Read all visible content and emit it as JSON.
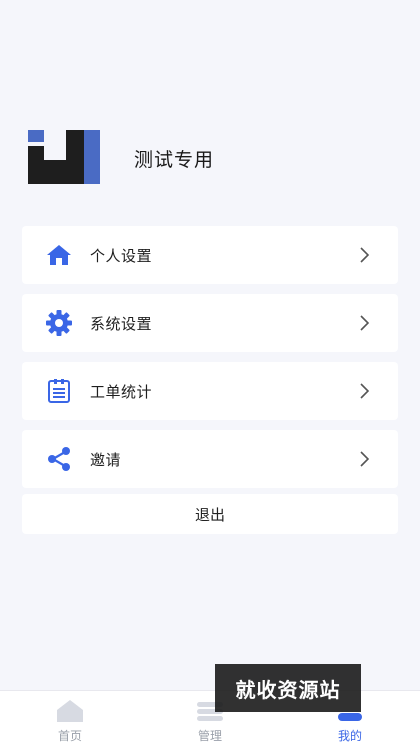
{
  "profile": {
    "username": "测试专用"
  },
  "menu": {
    "items": [
      {
        "label": "个人设置",
        "icon": "home-icon"
      },
      {
        "label": "系统设置",
        "icon": "gear-icon"
      },
      {
        "label": "工单统计",
        "icon": "clipboard-icon"
      },
      {
        "label": "邀请",
        "icon": "share-icon"
      }
    ],
    "logout_label": "退出"
  },
  "tabbar": {
    "tabs": [
      {
        "label": "首页",
        "icon": "home-tab-icon"
      },
      {
        "label": "管理",
        "icon": "manage-tab-icon"
      },
      {
        "label": "我的",
        "icon": "profile-tab-icon",
        "active": true
      }
    ]
  },
  "watermark": {
    "text": "就收资源站"
  },
  "colors": {
    "accent": "#3a66e6",
    "background": "#f5f6fb",
    "card": "#ffffff",
    "tab_inactive": "#9aa0aa"
  }
}
